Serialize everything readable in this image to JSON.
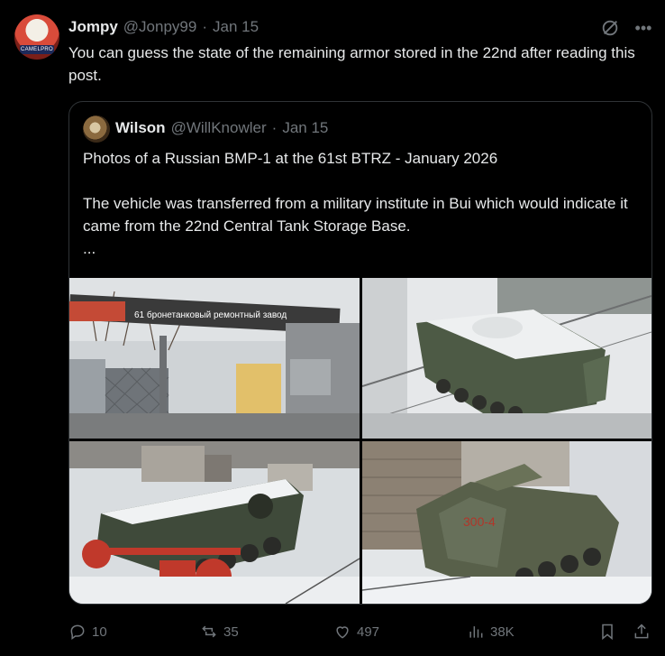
{
  "post": {
    "author_name": "Jompy",
    "author_handle": "@Jonpy99",
    "separator": "·",
    "date": "Jan 15",
    "avatar_caption": "CAMELPRO",
    "text": "You can guess the state of the remaining armor stored in the 22nd after reading this post."
  },
  "quoted": {
    "author_name": "Wilson",
    "author_handle": "@WillKnowler",
    "separator": "·",
    "date": "Jan 15",
    "text": "Photos of a Russian BMP-1 at the 61st BTRZ - January 2026\n\nThe vehicle was transferred from a military institute in Bui which would indicate it came from the 22nd Central Tank Storage Base.\n...",
    "sign_text": "61 бронетанковый ремонтный завод",
    "hull_marking": "300-4"
  },
  "actions": {
    "replies": "10",
    "reposts": "35",
    "likes": "497",
    "views": "38K"
  }
}
